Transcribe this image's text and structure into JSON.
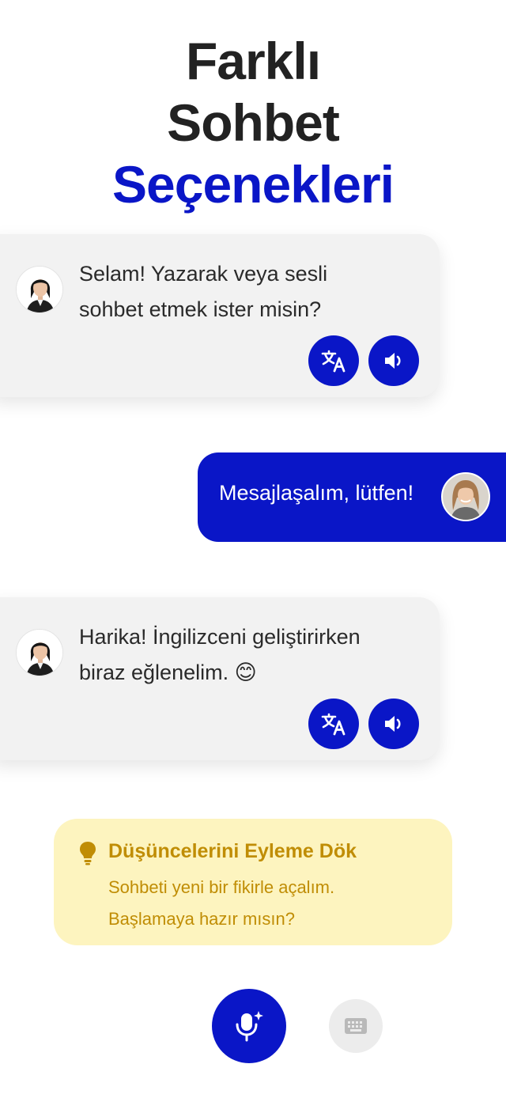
{
  "heading": {
    "line1": "Farklı",
    "line2": "Sohbet",
    "line3": "Seçenekleri"
  },
  "messages": [
    {
      "sender": "bot",
      "text_line1": "Selam! Yazarak veya sesli",
      "text_line2": "sohbet etmek ister misin?",
      "actions": [
        "translate-icon",
        "speaker-icon"
      ]
    },
    {
      "sender": "user",
      "text": "Mesajlaşalım, lütfen!"
    },
    {
      "sender": "bot",
      "text_line1": "Harika! İngilizceni geliştirirken",
      "text_line2": "biraz eğlenelim. 😊",
      "actions": [
        "translate-icon",
        "speaker-icon"
      ]
    }
  ],
  "tip": {
    "icon": "lightbulb-icon",
    "title": "Düşüncelerini Eyleme Dök",
    "body_line1": "Sohbeti yeni bir fikirle açalım.",
    "body_line2": "Başlamaya hazır mısın?"
  },
  "controls": {
    "mic_icon": "mic-sparkle-icon",
    "keyboard_icon": "keyboard-icon"
  },
  "colors": {
    "accent": "#0a16c7",
    "title": "#222222",
    "bot_bubble": "#f2f2f2",
    "tip_bg": "#fdf4bf",
    "tip_text": "#c08d05"
  }
}
